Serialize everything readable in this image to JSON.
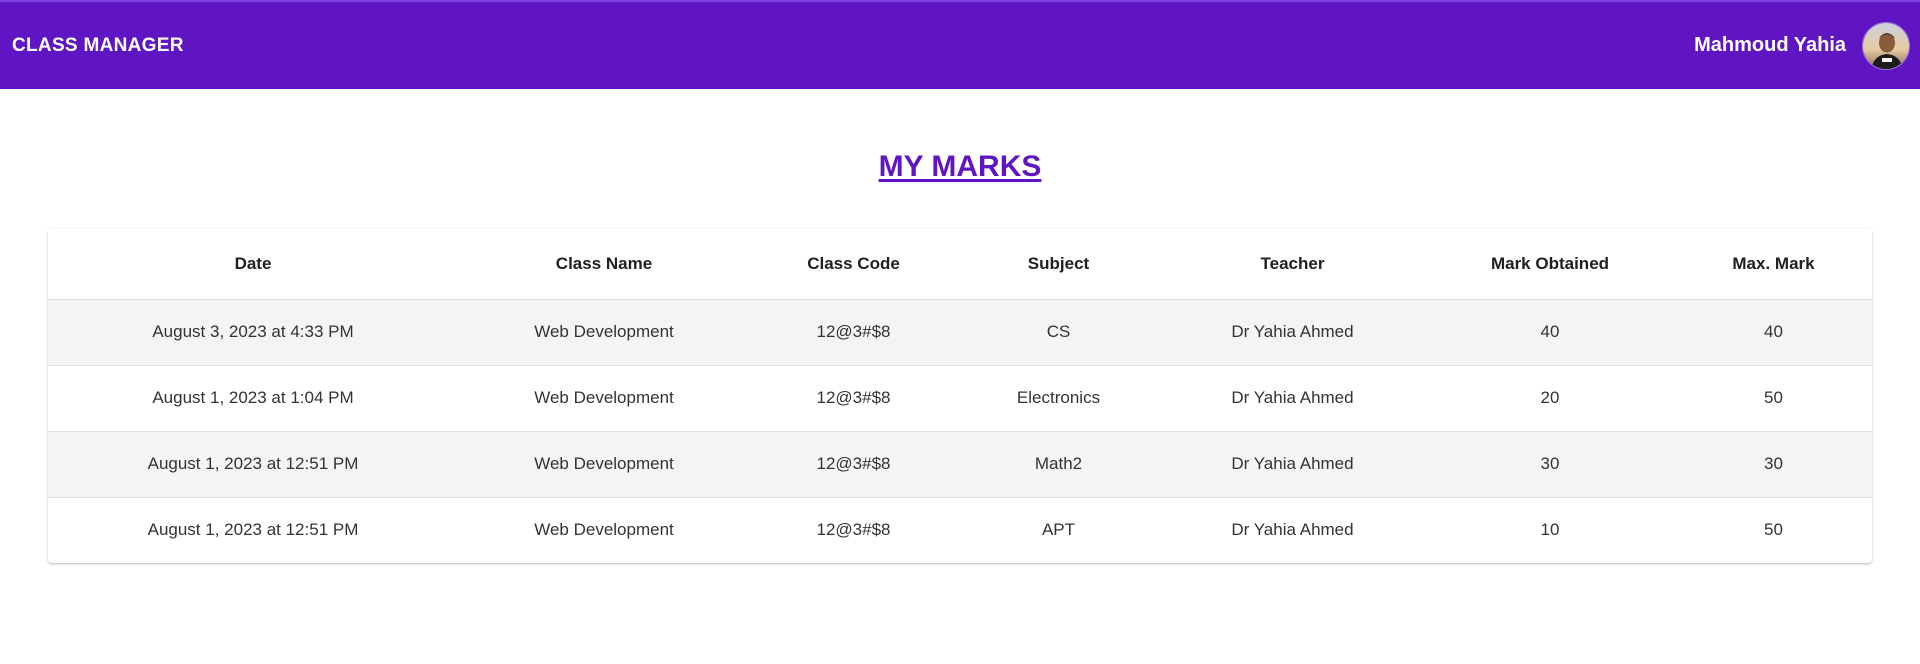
{
  "header": {
    "brand": "CLASS MANAGER",
    "user_name": "Mahmoud Yahia",
    "avatar_icon": "user-avatar",
    "background_color": "#5f16c2"
  },
  "page": {
    "title": "MY MARKS",
    "title_color": "#5f16c2"
  },
  "table": {
    "columns": [
      "Date",
      "Class Name",
      "Class Code",
      "Subject",
      "Teacher",
      "Mark Obtained",
      "Max. Mark"
    ],
    "rows": [
      [
        "August 3, 2023 at 4:33 PM",
        "Web Development",
        "12@3#$8",
        "CS",
        "Dr Yahia Ahmed",
        "40",
        "40"
      ],
      [
        "August 1, 2023 at 1:04 PM",
        "Web Development",
        "12@3#$8",
        "Electronics",
        "Dr Yahia Ahmed",
        "20",
        "50"
      ],
      [
        "August 1, 2023 at 12:51 PM",
        "Web Development",
        "12@3#$8",
        "Math2",
        "Dr Yahia Ahmed",
        "30",
        "30"
      ],
      [
        "August 1, 2023 at 12:51 PM",
        "Web Development",
        "12@3#$8",
        "APT",
        "Dr Yahia Ahmed",
        "10",
        "50"
      ]
    ]
  }
}
